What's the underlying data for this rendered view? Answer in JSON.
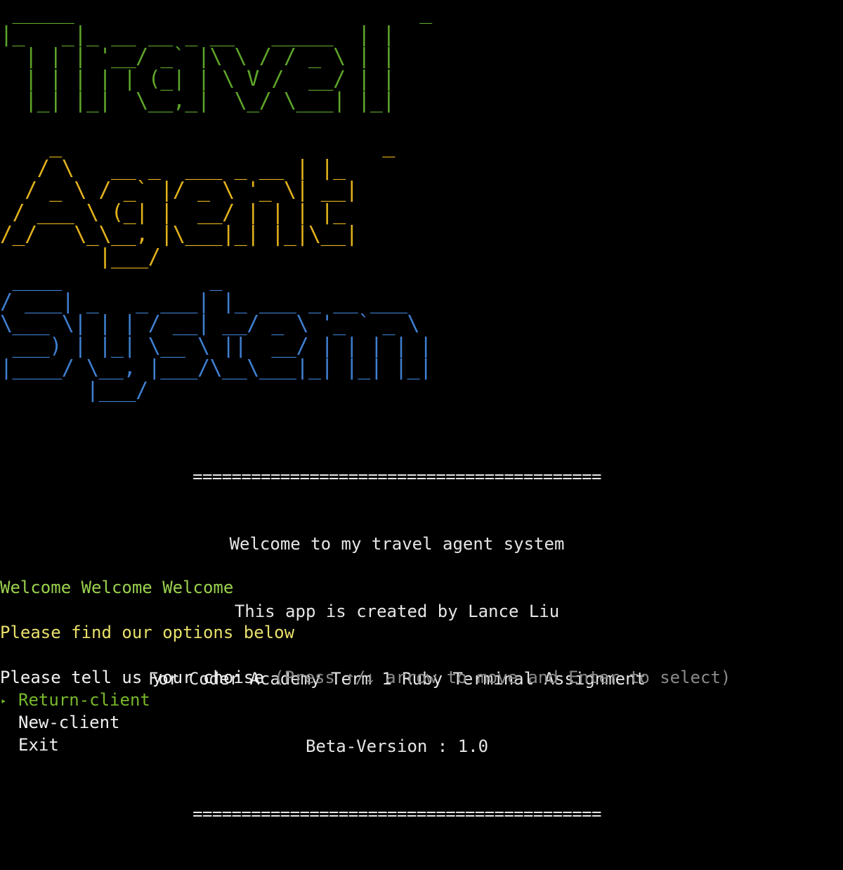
{
  "banner": {
    "travel": " _____                            _\n|_   _|_ __ __ _ __   _____  | |\n  | | | '__/ _` |\\ \\ / / _ \\ | |\n  | | | | | (_| | \\ V /  __/ | |\n  |_| |_|  \\__,_|  \\_/ \\___| |_|",
    "agent": "    _                          _\n   / \\   __ _  ___ _ __ | |_\n  / _ \\ / _` |/ _ \\ '_ \\| __|\n / ___ \\ (_| |  __/ | | | |_\n/_/   \\_\\__, |\\___|_| |_|\\__|\n        |___/",
    "system": " ____            _\n/ ___| _   _ ___| |_ ___ _ __ ___\n\\___ \\| | | / __| __/ _ \\ '_ ` _ \\\n ___) | |_| \\__ \\ ||  __/ | | | | |\n|____/ \\__, |___/\\__\\___|_| |_| |_|\n       |___/",
    "colors": {
      "travel": "#5ea52a",
      "agent": "#e3b21c",
      "system": "#3f7fd0"
    }
  },
  "info": {
    "rule": "==========================================",
    "line1": "Welcome to my travel agent system",
    "line2": "This app is created by Lance Liu",
    "line3": "For Coder Academy Term 1 Ruby Terminal Assignment",
    "line4": "Beta-Version : 1.0"
  },
  "greeting": "Welcome Welcome Welcome",
  "subtitle": "Please find our options below",
  "prompt": {
    "question": "Please tell us your choise",
    "hint": "(Press ↑/↓ arrow to move and Enter to select)"
  },
  "menu": {
    "pointer": "‣",
    "items": [
      {
        "label": "Return-client",
        "selected": true
      },
      {
        "label": "New-client",
        "selected": false
      },
      {
        "label": "Exit",
        "selected": false
      }
    ]
  }
}
